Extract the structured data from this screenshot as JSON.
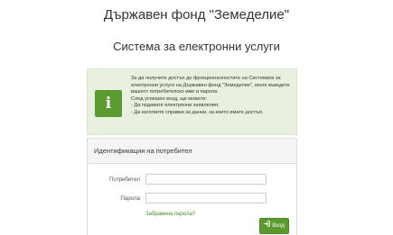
{
  "header": {
    "title": "Държавен фонд \"Земеделие\"",
    "subtitle": "Система за електронни услуги"
  },
  "info": {
    "icon": "info-icon",
    "accent_color": "#5b9a2e",
    "intro": "За да получите достъп до функционалностите на Системата за електронни услуги на Държавен фонд \"Земеделие\", моля въведете вашето потребителско име и парола.",
    "after_login": "След успешен вход, ще можете:",
    "bullet_1": "- Да подавате електронни заявления;",
    "bullet_2": "- Да изготвяте справки за данни, за които имате достъп."
  },
  "login": {
    "heading": "Идентификация на потребител",
    "username_label": "Потребител",
    "username_value": "",
    "password_label": "Парола",
    "password_value": "",
    "forgot_link": "Забравена парола?",
    "submit_label": "Вход",
    "submit_icon": "sign-in-icon"
  }
}
